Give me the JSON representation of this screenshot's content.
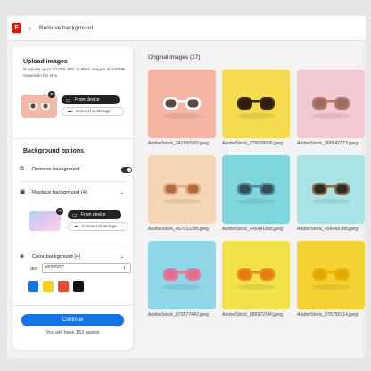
{
  "app": {
    "logo_letter": "F",
    "back_glyph": "‹",
    "title": "Remove background"
  },
  "upload": {
    "title": "Upload images",
    "desc_line1": "Supports up to 10,000 JPG or PNG images at 100MB",
    "desc_line2": "maximum file size.",
    "from_device": "From device",
    "connect_storage": "Connect to storage"
  },
  "options": {
    "title": "Background options",
    "remove_bg": "Remove background",
    "remove_bg_on": true,
    "replace_bg": "Replace background (4)",
    "from_device": "From device",
    "connect_storage": "Connect to storage",
    "color_bg": "Color background (4)",
    "hex_label": "HEX",
    "hex_value": "#0265DC",
    "swatches": [
      "#1473e6",
      "#f6d21c",
      "#ea4b2c",
      "#111111"
    ]
  },
  "footer": {
    "continue": "Continue",
    "assets": "You will have 153 assets"
  },
  "gallery": {
    "title": "Original images (17)",
    "images": [
      {
        "name": "AdobeStock_241950920.jpeg",
        "bg": "#f6b6a4",
        "frame": "#ffffff",
        "lens": "#5a4a3a"
      },
      {
        "name": "AdobeStock_279028006.jpeg",
        "bg": "#f5dc4e",
        "frame": "#3a2a1a",
        "lens": "#2a1e10"
      },
      {
        "name": "AdobeStock_300547373.jpeg",
        "bg": "#f4c9d3",
        "frame": "#b07a6a",
        "lens": "#9c6b5c"
      },
      {
        "name": "AdobeStock_457033395.jpeg",
        "bg": "#f6d6b4",
        "frame": "#d9b088",
        "lens": "#b56b3a"
      },
      {
        "name": "AdobeStock_496941888.jpeg",
        "bg": "#7fd6dc",
        "frame": "#4a8a9a",
        "lens": "#3a4a54"
      },
      {
        "name": "AdobeStock_496488788.jpeg",
        "bg": "#a9e3e6",
        "frame": "#8a6a4a",
        "lens": "#2e2a26"
      },
      {
        "name": "AdobeStock_872877442.jpeg",
        "bg": "#8ed6e8",
        "frame": "#e27a9a",
        "lens": "#e46c8c"
      },
      {
        "name": "AdobeStock_886972140.jpeg",
        "bg": "#f4e24a",
        "frame": "#f08a1a",
        "lens": "#e57a10"
      },
      {
        "name": "AdobeStock_975759714.jpeg",
        "bg": "#f5d233",
        "frame": "#e8b400",
        "lens": "#e0a800"
      }
    ]
  }
}
